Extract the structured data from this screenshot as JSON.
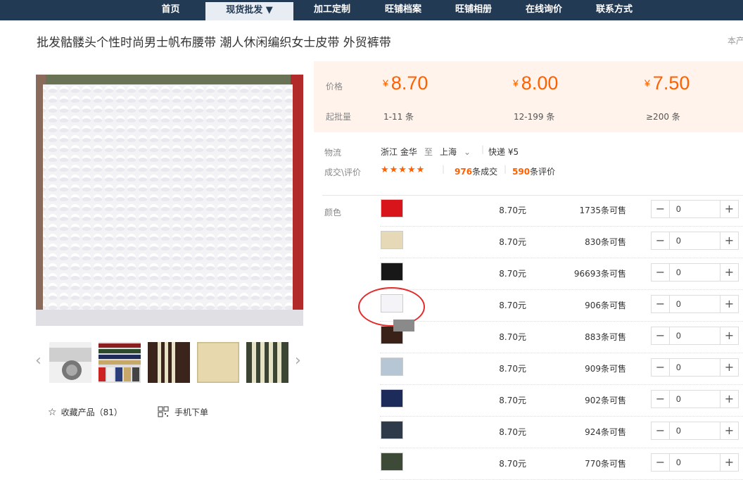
{
  "nav": {
    "items": [
      {
        "label": "首页"
      },
      {
        "label": "现货批发 ▼",
        "active": true
      },
      {
        "label": "加工定制"
      },
      {
        "label": "旺铺档案"
      },
      {
        "label": "旺铺相册"
      },
      {
        "label": "在线询价"
      },
      {
        "label": "联系方式"
      }
    ]
  },
  "product": {
    "title": "批发骷髅头个性时尚男士帆布腰带 潮人休闲编织女士皮带 外贸裤带",
    "title_right": "本产"
  },
  "gallery": {
    "thumbnails": [
      "belt-buckle-skull",
      "striped-belts",
      "brown-stripe-belt",
      "beige-belt",
      "olive-stripe-belt"
    ],
    "prev_icon": "chevron-left-icon",
    "next_icon": "chevron-right-icon"
  },
  "actions": {
    "favorite_label": "收藏产品（81）",
    "mobile_label": "手机下单"
  },
  "pricing": {
    "price_label": "价格",
    "qty_label": "起批量",
    "currency": "¥",
    "tiers": [
      {
        "price": "8.70",
        "range": "1-11 条"
      },
      {
        "price": "8.00",
        "range": "12-199 条"
      },
      {
        "price": "7.50",
        "range": "≥200 条"
      }
    ]
  },
  "logistics": {
    "label": "物流",
    "from": "浙江 金华",
    "to_word": "至",
    "to": "上海",
    "express": "快递 ¥5"
  },
  "reviews": {
    "label": "成交\\评价",
    "stars": "★★★★★",
    "sold_count": "976",
    "sold_suffix": "条成交",
    "review_count": "590",
    "review_suffix": "条评价"
  },
  "variants": {
    "label": "颜色",
    "rows": [
      {
        "color": "#d8151a",
        "price": "8.70元",
        "stock": "1735条可售",
        "qty": "0"
      },
      {
        "color": "#e6d9b8",
        "price": "8.70元",
        "stock": "830条可售",
        "qty": "0"
      },
      {
        "color": "#181818",
        "price": "8.70元",
        "stock": "96693条可售",
        "qty": "0"
      },
      {
        "color": "#f4f4f8",
        "price": "8.70元",
        "stock": "906条可售",
        "qty": "0"
      },
      {
        "color": "#3b2218",
        "price": "8.70元",
        "stock": "883条可售",
        "qty": "0"
      },
      {
        "color": "#b7c6d4",
        "price": "8.70元",
        "stock": "909条可售",
        "qty": "0"
      },
      {
        "color": "#1c2b5a",
        "price": "8.70元",
        "stock": "902条可售",
        "qty": "0"
      },
      {
        "color": "#2e3a4a",
        "price": "8.70元",
        "stock": "924条可售",
        "qty": "0"
      },
      {
        "color": "#3d4a38",
        "price": "8.70元",
        "stock": "770条可售",
        "qty": "0"
      }
    ]
  }
}
